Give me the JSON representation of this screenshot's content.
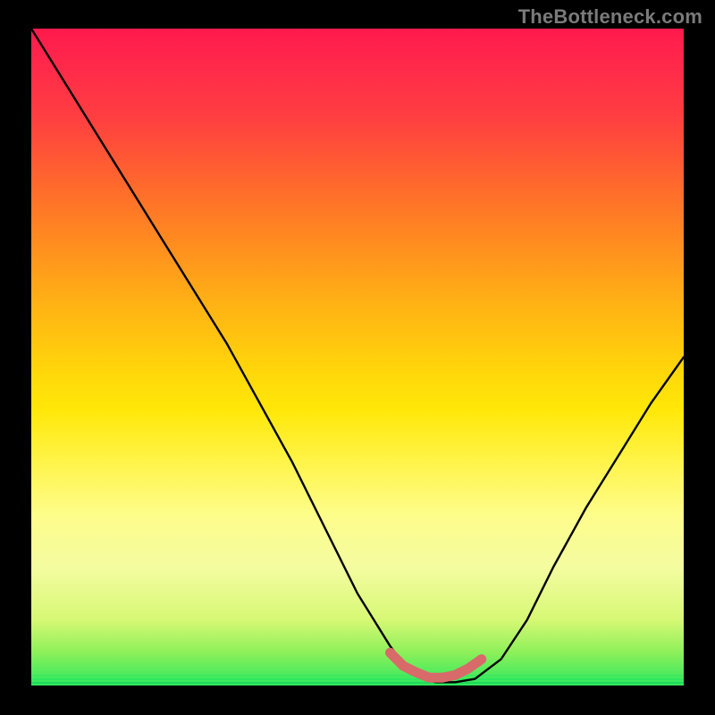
{
  "watermark": "TheBottleneck.com",
  "colors": {
    "page_bg": "#000000",
    "curve": "#000000",
    "marker": "#d86a6a",
    "gradient_top": "#ff1a4d",
    "gradient_bottom": "#2ee85e"
  },
  "chart_data": {
    "type": "line",
    "title": "",
    "xlabel": "",
    "ylabel": "",
    "xlim": [
      0,
      100
    ],
    "ylim": [
      0,
      100
    ],
    "x": [
      0,
      5,
      10,
      15,
      20,
      25,
      30,
      35,
      40,
      45,
      50,
      55,
      58,
      60,
      62,
      65,
      68,
      72,
      76,
      80,
      85,
      90,
      95,
      100
    ],
    "series": [
      {
        "name": "bottleneck-curve",
        "values": [
          100,
          92,
          84,
          76,
          68,
          60,
          52,
          43,
          34,
          24,
          14,
          6,
          2,
          1,
          0.5,
          0.5,
          1,
          4,
          10,
          18,
          27,
          35,
          43,
          50
        ]
      }
    ],
    "marker_segment": {
      "name": "optimal-range",
      "x": [
        55,
        57,
        59,
        61,
        63,
        65,
        67,
        69
      ],
      "values": [
        5,
        3,
        2,
        1.2,
        1.2,
        1.6,
        2.6,
        4
      ]
    }
  }
}
